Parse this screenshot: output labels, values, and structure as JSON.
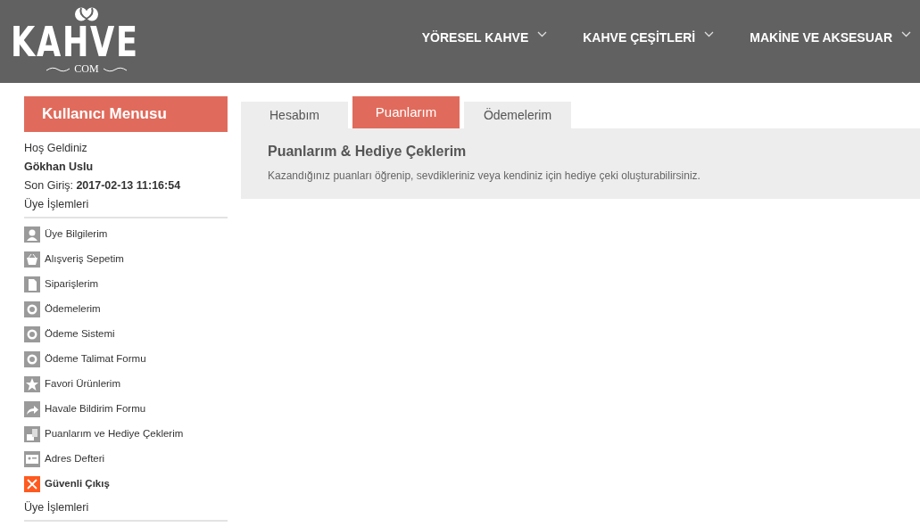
{
  "logo": {
    "name": "KAHVE",
    "suffix": "COM"
  },
  "nav": [
    {
      "label": "YÖRESEL KAHVE"
    },
    {
      "label": "KAHVE ÇEŞİTLERİ"
    },
    {
      "label": "MAKİNE VE AKSESUAR"
    }
  ],
  "sidebar": {
    "title": "Kullanıcı Menusu",
    "welcome": "Hoş Geldiniz",
    "user": "Gökhan Uslu",
    "last_login_label": "Son Giriş:",
    "last_login": "2017-02-13 11:16:54",
    "section": "Üye İşlemleri",
    "items": [
      {
        "label": "Üye Bilgilerim",
        "kind": "user"
      },
      {
        "label": "Alışveriş Sepetim",
        "kind": "basket"
      },
      {
        "label": "Siparişlerim",
        "kind": "document"
      },
      {
        "label": "Ödemelerim",
        "kind": "coin"
      },
      {
        "label": "Ödeme Sistemi",
        "kind": "coin"
      },
      {
        "label": "Ödeme Talimat Formu",
        "kind": "coin"
      },
      {
        "label": "Favori Ürünlerim",
        "kind": "star"
      },
      {
        "label": "Havale Bildirim Formu",
        "kind": "share"
      },
      {
        "label": "Puanlarım ve Hediye Çeklerim",
        "kind": "coins"
      },
      {
        "label": "Adres Defteri",
        "kind": "card"
      },
      {
        "label": "Güvenli Çıkış",
        "kind": "exit"
      }
    ],
    "footer": "Üye İşlemleri"
  },
  "tabs": [
    {
      "label": "Hesabım",
      "selected": false
    },
    {
      "label": "Puanlarım",
      "selected": true
    },
    {
      "label": "Ödemelerim",
      "selected": false
    }
  ],
  "panel": {
    "title": "Puanlarım & Hediye Çeklerim",
    "description": "Kazandığınız puanları öğrenip, sevdikleriniz veya kendiniz için hediye çeki oluşturabilirsiniz."
  }
}
